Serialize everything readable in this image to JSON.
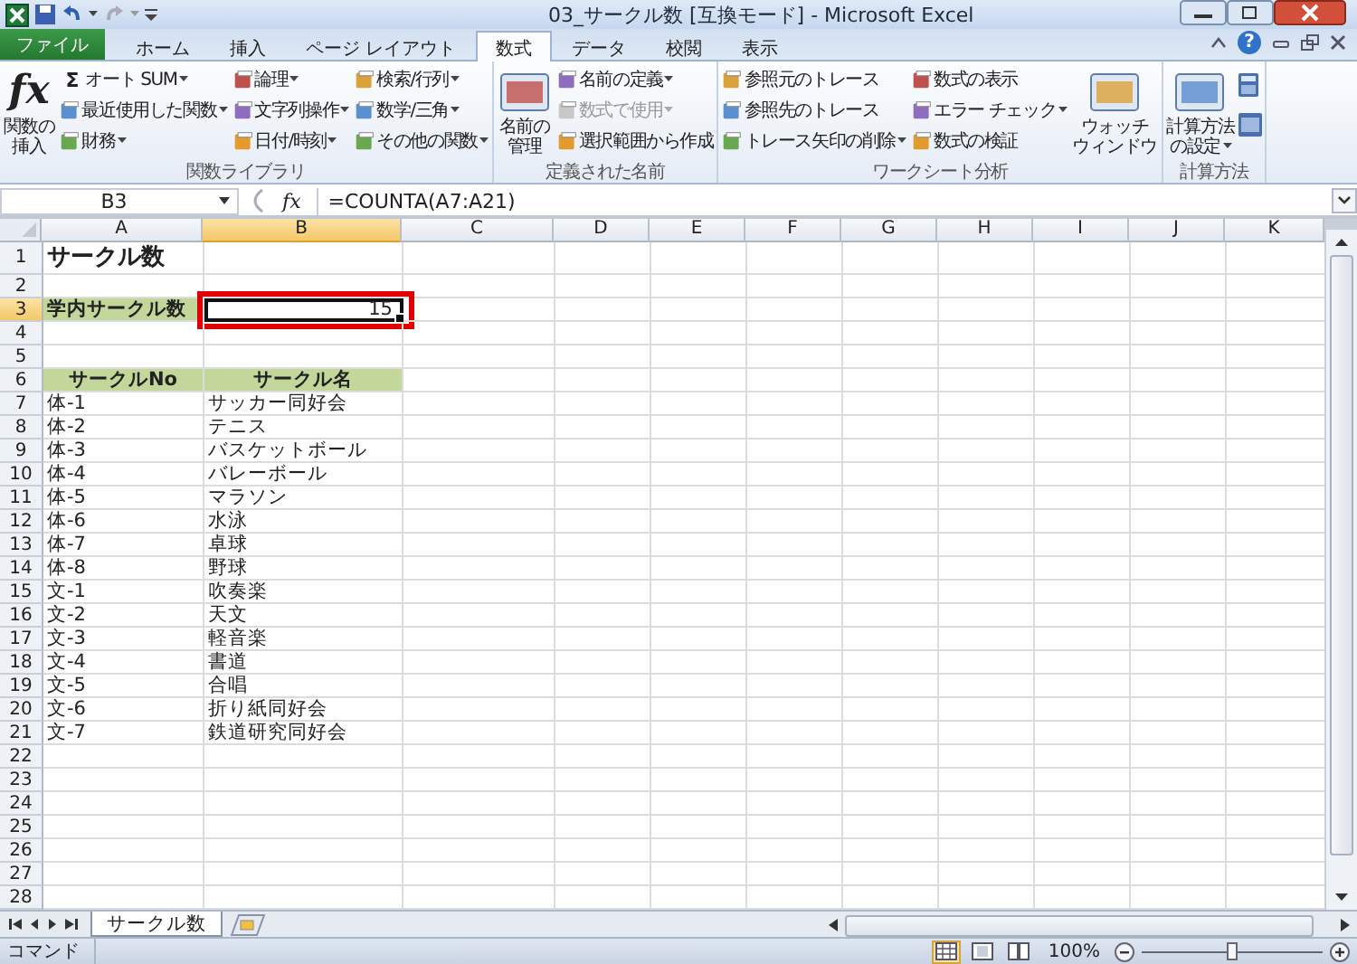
{
  "window": {
    "title": "03_サークル数 [互換モード] - Microsoft Excel",
    "help": "?"
  },
  "tabs": [
    {
      "label": "ファイル",
      "kind": "file",
      "selected": false
    },
    {
      "label": "ホーム",
      "kind": "tab",
      "selected": false
    },
    {
      "label": "挿入",
      "kind": "tab",
      "selected": false
    },
    {
      "label": "ページ レイアウト",
      "kind": "tab",
      "selected": false
    },
    {
      "label": "数式",
      "kind": "tab",
      "selected": true
    },
    {
      "label": "データ",
      "kind": "tab",
      "selected": false
    },
    {
      "label": "校閲",
      "kind": "tab",
      "selected": false
    },
    {
      "label": "表示",
      "kind": "tab",
      "selected": false
    }
  ],
  "ribbon": {
    "groups": [
      {
        "label": "関数ライブラリ",
        "parts": [
          {
            "kind": "big",
            "lines": [
              "関数の",
              "挿入"
            ],
            "glyph": "fx",
            "dropdown": false
          },
          {
            "kind": "column",
            "items": [
              {
                "label": "オート SUM",
                "glyph": "Σ",
                "dropdown": true,
                "disabled": false
              },
              {
                "label": "最近使用した関数",
                "dropdown": true,
                "disabled": false
              },
              {
                "label": "財務",
                "dropdown": true,
                "disabled": false
              }
            ]
          },
          {
            "kind": "column",
            "items": [
              {
                "label": "論理",
                "dropdown": true,
                "disabled": false
              },
              {
                "label": "文字列操作",
                "dropdown": true,
                "disabled": false
              },
              {
                "label": "日付/時刻",
                "dropdown": true,
                "disabled": false
              }
            ]
          },
          {
            "kind": "column",
            "items": [
              {
                "label": "検索/行列",
                "dropdown": true,
                "disabled": false
              },
              {
                "label": "数学/三角",
                "dropdown": true,
                "disabled": false
              },
              {
                "label": "その他の関数",
                "dropdown": true,
                "disabled": false
              }
            ]
          }
        ]
      },
      {
        "label": "定義された名前",
        "parts": [
          {
            "kind": "big",
            "lines": [
              "名前の",
              "管理"
            ],
            "dropdown": false
          },
          {
            "kind": "column",
            "items": [
              {
                "label": "名前の定義",
                "dropdown": true,
                "disabled": false
              },
              {
                "label": "数式で使用",
                "dropdown": true,
                "disabled": true
              },
              {
                "label": "選択範囲から作成",
                "dropdown": false,
                "disabled": false
              }
            ]
          }
        ]
      },
      {
        "label": "ワークシート分析",
        "parts": [
          {
            "kind": "column",
            "items": [
              {
                "label": "参照元のトレース",
                "dropdown": false,
                "disabled": false
              },
              {
                "label": "参照先のトレース",
                "dropdown": false,
                "disabled": false
              },
              {
                "label": "トレース矢印の削除",
                "dropdown": true,
                "disabled": false
              }
            ]
          },
          {
            "kind": "column",
            "items": [
              {
                "label": "数式の表示",
                "dropdown": false,
                "disabled": false
              },
              {
                "label": "エラー チェック",
                "dropdown": true,
                "disabled": false
              },
              {
                "label": "数式の検証",
                "dropdown": false,
                "disabled": false
              }
            ]
          },
          {
            "kind": "big",
            "lines": [
              "ウォッチ",
              "ウィンドウ"
            ],
            "dropdown": false
          }
        ]
      },
      {
        "label": "計算方法",
        "parts": [
          {
            "kind": "big",
            "lines": [
              "計算方法",
              "の設定"
            ],
            "dropdown": true
          },
          {
            "kind": "calc-icons"
          }
        ]
      }
    ]
  },
  "formula_bar": {
    "name_box": "B3",
    "fx": "fx",
    "formula": "=COUNTA(A7:A21)"
  },
  "sheet": {
    "active_highlight": true,
    "columns": [
      {
        "label": "A",
        "selected": false
      },
      {
        "label": "B",
        "selected": true
      },
      {
        "label": "C",
        "selected": false
      },
      {
        "label": "D",
        "selected": false
      },
      {
        "label": "E",
        "selected": false
      },
      {
        "label": "F",
        "selected": false
      },
      {
        "label": "G",
        "selected": false
      },
      {
        "label": "H",
        "selected": false
      },
      {
        "label": "I",
        "selected": false
      },
      {
        "label": "J",
        "selected": false
      },
      {
        "label": "K",
        "selected": false
      }
    ],
    "rows": [
      {
        "number": "1",
        "kind": "title",
        "selected": false,
        "cells": [
          {
            "text": "サークル数",
            "selected": false
          }
        ]
      },
      {
        "number": "2",
        "kind": "data",
        "selected": false
      },
      {
        "number": "3",
        "kind": "label",
        "selected": true,
        "cells": [
          {
            "text": "学内サークル数",
            "selected": false
          },
          {
            "text": "15",
            "selected": true
          }
        ]
      },
      {
        "number": "4",
        "kind": "data",
        "selected": false
      },
      {
        "number": "5",
        "kind": "data",
        "selected": false
      },
      {
        "number": "6",
        "kind": "header",
        "selected": false,
        "cells": [
          {
            "text": "サークルNo",
            "selected": false
          },
          {
            "text": "サークル名",
            "selected": false
          }
        ]
      },
      {
        "number": "7",
        "kind": "data",
        "selected": false,
        "cells": [
          {
            "text": "体-1",
            "selected": false
          },
          {
            "text": "サッカー同好会",
            "selected": false
          }
        ]
      },
      {
        "number": "8",
        "kind": "data",
        "selected": false,
        "cells": [
          {
            "text": "体-2",
            "selected": false
          },
          {
            "text": "テニス",
            "selected": false
          }
        ]
      },
      {
        "number": "9",
        "kind": "data",
        "selected": false,
        "cells": [
          {
            "text": "体-3",
            "selected": false
          },
          {
            "text": "バスケットボール",
            "selected": false
          }
        ]
      },
      {
        "number": "10",
        "kind": "data",
        "selected": false,
        "cells": [
          {
            "text": "体-4",
            "selected": false
          },
          {
            "text": "バレーボール",
            "selected": false
          }
        ]
      },
      {
        "number": "11",
        "kind": "data",
        "selected": false,
        "cells": [
          {
            "text": "体-5",
            "selected": false
          },
          {
            "text": "マラソン",
            "selected": false
          }
        ]
      },
      {
        "number": "12",
        "kind": "data",
        "selected": false,
        "cells": [
          {
            "text": "体-6",
            "selected": false
          },
          {
            "text": "水泳",
            "selected": false
          }
        ]
      },
      {
        "number": "13",
        "kind": "data",
        "selected": false,
        "cells": [
          {
            "text": "体-7",
            "selected": false
          },
          {
            "text": "卓球",
            "selected": false
          }
        ]
      },
      {
        "number": "14",
        "kind": "data",
        "selected": false,
        "cells": [
          {
            "text": "体-8",
            "selected": false
          },
          {
            "text": "野球",
            "selected": false
          }
        ]
      },
      {
        "number": "15",
        "kind": "data",
        "selected": false,
        "cells": [
          {
            "text": "文-1",
            "selected": false
          },
          {
            "text": "吹奏楽",
            "selected": false
          }
        ]
      },
      {
        "number": "16",
        "kind": "data",
        "selected": false,
        "cells": [
          {
            "text": "文-2",
            "selected": false
          },
          {
            "text": "天文",
            "selected": false
          }
        ]
      },
      {
        "number": "17",
        "kind": "data",
        "selected": false,
        "cells": [
          {
            "text": "文-3",
            "selected": false
          },
          {
            "text": "軽音楽",
            "selected": false
          }
        ]
      },
      {
        "number": "18",
        "kind": "data",
        "selected": false,
        "cells": [
          {
            "text": "文-4",
            "selected": false
          },
          {
            "text": "書道",
            "selected": false
          }
        ]
      },
      {
        "number": "19",
        "kind": "data",
        "selected": false,
        "cells": [
          {
            "text": "文-5",
            "selected": false
          },
          {
            "text": "合唱",
            "selected": false
          }
        ]
      },
      {
        "number": "20",
        "kind": "data",
        "selected": false,
        "cells": [
          {
            "text": "文-6",
            "selected": false
          },
          {
            "text": "折り紙同好会",
            "selected": false
          }
        ]
      },
      {
        "number": "21",
        "kind": "data",
        "selected": false,
        "cells": [
          {
            "text": "文-7",
            "selected": false
          },
          {
            "text": "鉄道研究同好会",
            "selected": false
          }
        ]
      },
      {
        "number": "22",
        "kind": "data",
        "selected": false
      },
      {
        "number": "23",
        "kind": "data",
        "selected": false
      },
      {
        "number": "24",
        "kind": "data",
        "selected": false
      },
      {
        "number": "25",
        "kind": "data",
        "selected": false
      },
      {
        "number": "26",
        "kind": "data",
        "selected": false
      },
      {
        "number": "27",
        "kind": "data",
        "selected": false
      },
      {
        "number": "28",
        "kind": "data",
        "selected": false
      }
    ]
  },
  "sheet_tabs": [
    {
      "label": "サークル数",
      "selected": true
    }
  ],
  "status_bar": {
    "mode": "コマンド",
    "views": [
      {
        "selected": true
      },
      {
        "selected": false
      },
      {
        "selected": false
      }
    ],
    "zoom": "100%",
    "zoom_slider": {
      "level": 0.5
    }
  }
}
